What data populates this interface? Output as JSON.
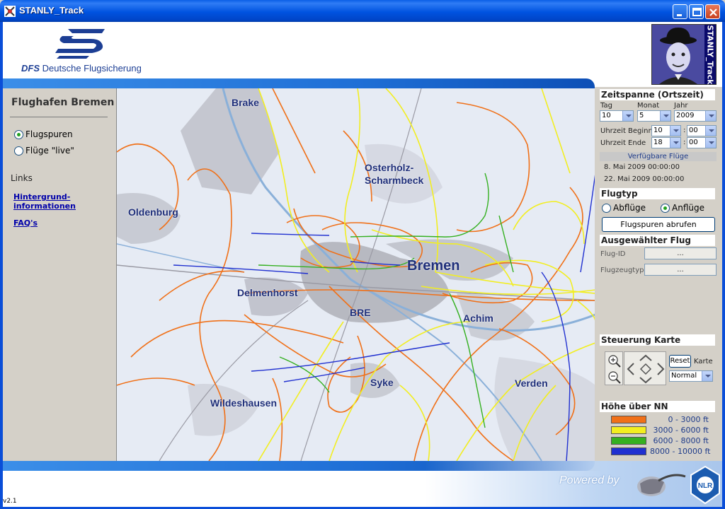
{
  "window": {
    "title": "STANLY_Track"
  },
  "header": {
    "org_abbrev": "DFS",
    "org_name": "Deutsche Flugsicherung",
    "app_label": "STANLY_Track"
  },
  "sidebar": {
    "title": "Flughafen Bremen",
    "modes": [
      {
        "label": "Flugspuren",
        "selected": true
      },
      {
        "label": "Flüge \"live\"",
        "selected": false
      }
    ],
    "links_title": "Links",
    "links": [
      {
        "label_line1": "Hintergrund-",
        "label_line2": "informationen"
      },
      {
        "label_line1": "FAQ's"
      }
    ]
  },
  "map": {
    "labels": {
      "brake": "Brake",
      "osterholz1": "Osterholz-",
      "osterholz2": "Scharmbeck",
      "oldenburg": "Oldenburg",
      "bremen": "Bremen",
      "delmenhorst": "Delmenhorst",
      "bre": "BRE",
      "achim": "Achim",
      "syke": "Syke",
      "verden": "Verden",
      "wildeshausen": "Wildeshausen"
    },
    "track_colors": {
      "low": "#f07018",
      "mid": "#f2ee20",
      "high": "#34b020",
      "top": "#2030d0"
    }
  },
  "timespan": {
    "title": "Zeitspanne (Ortszeit)",
    "day_label": "Tag",
    "month_label": "Monat",
    "year_label": "Jahr",
    "day": "10",
    "month": "5",
    "year": "2009",
    "start_label": "Uhrzeit Beginn",
    "start_hour": "10",
    "start_min": "00",
    "end_label": "Uhrzeit Ende",
    "end_hour": "18",
    "end_min": "00",
    "available_label": "Verfügbare Flüge",
    "available": [
      "8. Mai 2009 00:00:00",
      "22. Mai 2009 00:00:00"
    ]
  },
  "flighttype": {
    "title": "Flugtyp",
    "departures": "Abflüge",
    "arrivals": "Anflüge",
    "selected": "arrivals",
    "fetch_button": "Flugspuren abrufen"
  },
  "selected_flight": {
    "title": "Ausgewählter Flug",
    "id_label": "Flug-ID",
    "id_value": "...",
    "type_label": "Flugzeugtyp",
    "type_value": "..."
  },
  "map_control": {
    "title": "Steuerung Karte",
    "reset_button": "Reset",
    "map_label": "Karte",
    "map_mode": "Normal"
  },
  "altitude": {
    "title": "Höhe über NN",
    "bands": [
      {
        "label": "0 -   3000 ft",
        "color": "#f07018"
      },
      {
        "label": "3000 -   6000 ft",
        "color": "#f2ee20"
      },
      {
        "label": "6000 -   8000 ft",
        "color": "#34b020"
      },
      {
        "label": "8000 - 10000 ft",
        "color": "#2030d0"
      }
    ]
  },
  "footer": {
    "powered_by": "Powered by",
    "version": "v2.1"
  }
}
